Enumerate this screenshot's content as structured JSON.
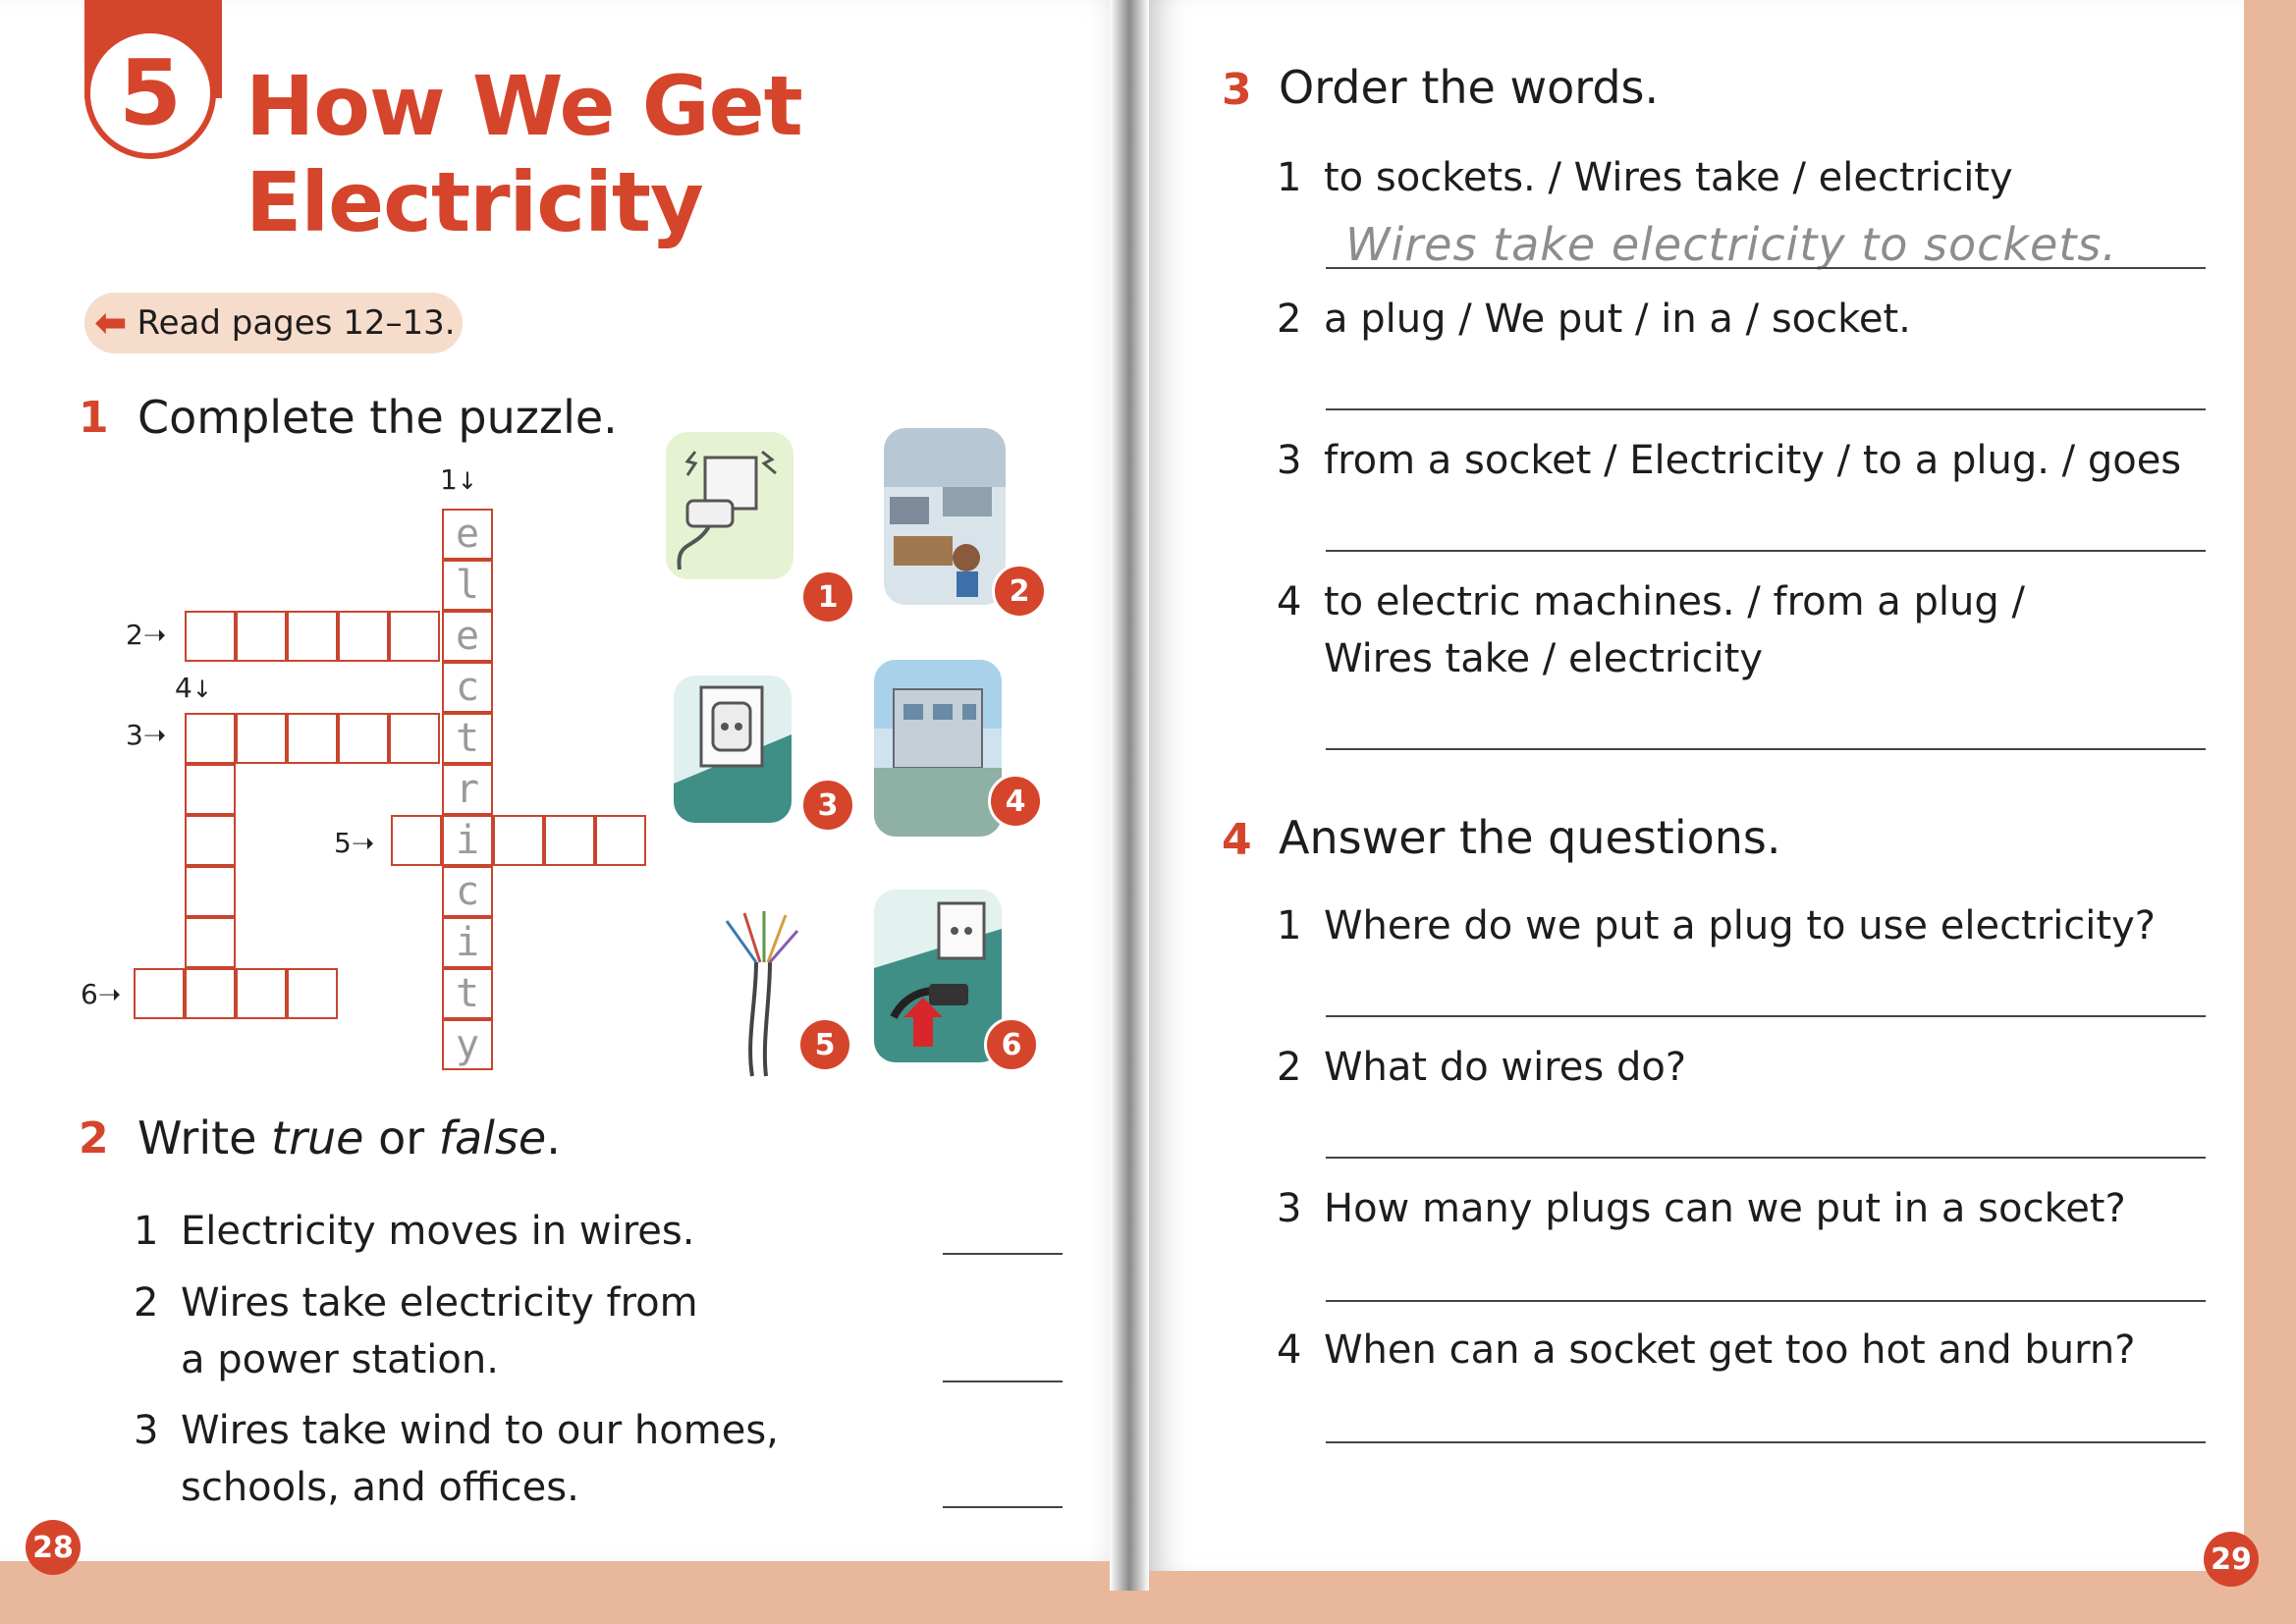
{
  "left_page": {
    "unit_number": "5",
    "title_line1": "How We Get",
    "title_line2": "Electricity",
    "read_pages": "Read pages 12–13.",
    "page_number": "28",
    "exercise1": {
      "number": "1",
      "title": "Complete the puzzle.",
      "clue_labels": [
        "1",
        "2",
        "3",
        "4",
        "5",
        "6"
      ],
      "solved_word_letters": [
        "e",
        "l",
        "e",
        "c",
        "t",
        "r",
        "i",
        "c",
        "i",
        "t",
        "y"
      ],
      "picture_badges": [
        "1",
        "2",
        "3",
        "4",
        "5",
        "6"
      ]
    },
    "exercise2": {
      "number": "2",
      "title_prefix": "Write ",
      "title_true": "true",
      "title_or": " or ",
      "title_false": "false",
      "title_suffix": ".",
      "items": [
        {
          "n": "1",
          "line1": "Electricity moves in wires.",
          "line2": ""
        },
        {
          "n": "2",
          "line1": "Wires take electricity from",
          "line2": "a power station."
        },
        {
          "n": "3",
          "line1": "Wires take wind to our homes,",
          "line2": "schools, and offices."
        }
      ]
    }
  },
  "right_page": {
    "page_number": "29",
    "exercise3": {
      "number": "3",
      "title": "Order the words.",
      "items": [
        {
          "n": "1",
          "line1": "to sockets. / Wires take / electricity",
          "line2": "",
          "answer": "Wires take electricity to sockets."
        },
        {
          "n": "2",
          "line1": "a plug / We put / in a  / socket.",
          "line2": "",
          "answer": ""
        },
        {
          "n": "3",
          "line1": "from a socket / Electricity / to a plug. / goes",
          "line2": "",
          "answer": ""
        },
        {
          "n": "4",
          "line1": "to electric machines. / from a plug /",
          "line2": "Wires take / electricity",
          "answer": ""
        }
      ]
    },
    "exercise4": {
      "number": "4",
      "title": "Answer the questions.",
      "items": [
        {
          "n": "1",
          "text": "Where do we put a plug to use electricity?"
        },
        {
          "n": "2",
          "text": "What do wires do?"
        },
        {
          "n": "3",
          "text": "How many plugs can we put in a socket?"
        },
        {
          "n": "4",
          "text": "When can a socket get too hot and burn?"
        }
      ]
    }
  },
  "colors": {
    "accent": "#d5452c",
    "grid": "#c8452e",
    "page_bg": "#e9b79c",
    "pill": "#f6dccb"
  }
}
